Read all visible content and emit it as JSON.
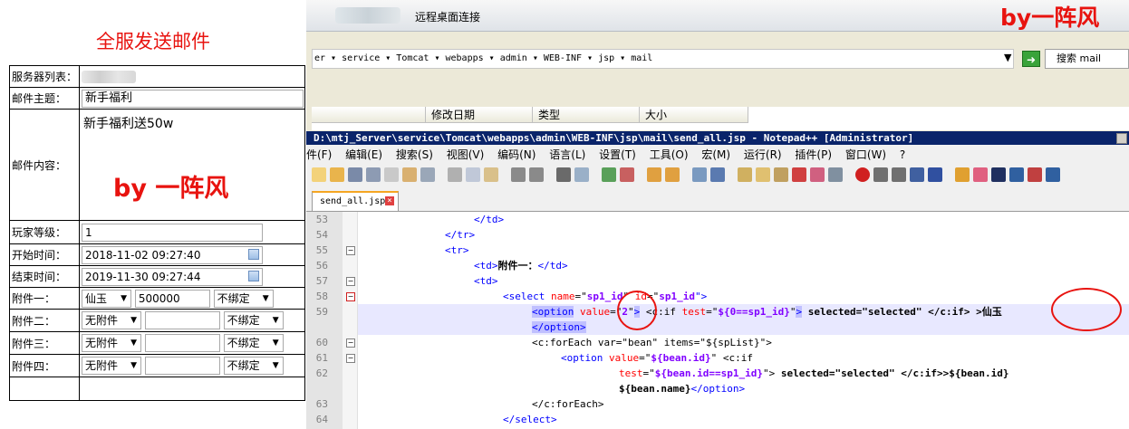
{
  "form": {
    "title": "全服发送邮件",
    "rows": {
      "server_label": "服务器列表：",
      "subject_label": "邮件主题：",
      "subject_value": "新手福利",
      "content_label": "邮件内容：",
      "content_value": "新手福利送50w",
      "content_watermark": "by 一阵风",
      "level_label": "玩家等级：",
      "level_value": "1",
      "start_label": "开始时间：",
      "start_value": "2018-11-02 09:27:40",
      "end_label": "结束时间：",
      "end_value": "2019-11-30 09:27:44",
      "attach1_label": "附件一：",
      "attach1_item": "仙玉",
      "attach1_qty": "500000",
      "attach1_bind": "不绑定",
      "attach2_label": "附件二：",
      "attach2_item": "无附件",
      "attach2_bind": "不绑定",
      "attach3_label": "附件三：",
      "attach3_item": "无附件",
      "attach3_bind": "不绑定",
      "attach4_label": "附件四：",
      "attach4_item": "无附件",
      "attach4_bind": "不绑定"
    }
  },
  "rdp": {
    "title": "远程桌面连接",
    "watermark": "by一阵风",
    "address_path": "er ▾ service ▾ Tomcat ▾ webapps ▾ admin ▾ WEB-INF ▾ jsp ▾ mail",
    "search_placeholder": "搜索 mail",
    "columns": [
      "修改日期",
      "类型",
      "大小"
    ]
  },
  "npp": {
    "title": "D:\\mtj_Server\\service\\Tomcat\\webapps\\admin\\WEB-INF\\jsp\\mail\\send_all.jsp - Notepad++ [Administrator]",
    "menu": [
      "件(F)",
      "编辑(E)",
      "搜索(S)",
      "视图(V)",
      "编码(N)",
      "语言(L)",
      "设置(T)",
      "工具(O)",
      "宏(M)",
      "运行(R)",
      "插件(P)",
      "窗口(W)",
      "?"
    ],
    "tab": "send_all.jsp",
    "lines": {
      "n53": "53",
      "n54": "54",
      "n55": "55",
      "n56": "56",
      "n57": "57",
      "n58": "58",
      "n59": "59",
      "n60": "60",
      "n61": "61",
      "n62": "62",
      "n63": "63",
      "n64": "64"
    },
    "code": {
      "l53": "</td>",
      "l54": "</tr>",
      "l55": "<tr>",
      "l56_open": "<td>",
      "l56_text": "附件一：",
      "l56_close": "</td>",
      "l57": "<td>",
      "l58_a": "<select ",
      "l58_b": "name",
      "l58_c": "=\"",
      "l58_d": "sp1_id",
      "l58_e": "\" ",
      "l58_f": "id",
      "l58_g": "=\"",
      "l58_h": "sp1_id",
      "l58_i": "\">",
      "l59_a": "<option",
      "l59_b": " value",
      "l59_c": "=\"",
      "l59_d": "2",
      "l59_e": "\"",
      "l59_f": ">",
      "l59_g": " <c:if ",
      "l59_h": "test",
      "l59_i": "=\"",
      "l59_j": "${0==sp1_id}",
      "l59_k": "\"",
      "l59_l": ">",
      "l59_m": " selected=\"selected\" </c:if>",
      "l59_n": " >仙玉",
      "l59b": "</option>",
      "l60": "<c:forEach var=\"bean\" items=\"${spList}\">",
      "l61_a": "<option ",
      "l61_b": "value",
      "l61_c": "=\"",
      "l61_d": "${bean.id}",
      "l61_e": "\" <c:if",
      "l62_a": "test",
      "l62_b": "=\"",
      "l62_c": "${bean.id==sp1_id}",
      "l62_d": "\"> ",
      "l62_e": "selected=\"selected\" </c:if>>${bean.id}",
      "l62b_a": "${bean.name}",
      "l62b_b": "</option>",
      "l63": "</c:forEach>",
      "l64": "</select>"
    }
  },
  "colors": {
    "accent_red": "#e8130f",
    "npp_title": "#0a246a",
    "tag_blue": "#0000ff",
    "attr_red": "#ff0000",
    "value_purple": "#8000ff"
  }
}
